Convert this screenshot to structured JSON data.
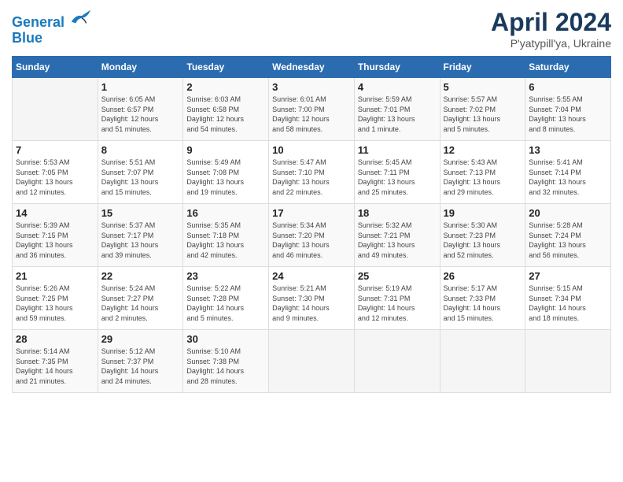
{
  "header": {
    "logo_line1": "General",
    "logo_line2": "Blue",
    "title": "April 2024",
    "subtitle": "P'yatypill'ya, Ukraine"
  },
  "columns": [
    "Sunday",
    "Monday",
    "Tuesday",
    "Wednesday",
    "Thursday",
    "Friday",
    "Saturday"
  ],
  "weeks": [
    [
      {
        "day": "",
        "info": ""
      },
      {
        "day": "1",
        "info": "Sunrise: 6:05 AM\nSunset: 6:57 PM\nDaylight: 12 hours\nand 51 minutes."
      },
      {
        "day": "2",
        "info": "Sunrise: 6:03 AM\nSunset: 6:58 PM\nDaylight: 12 hours\nand 54 minutes."
      },
      {
        "day": "3",
        "info": "Sunrise: 6:01 AM\nSunset: 7:00 PM\nDaylight: 12 hours\nand 58 minutes."
      },
      {
        "day": "4",
        "info": "Sunrise: 5:59 AM\nSunset: 7:01 PM\nDaylight: 13 hours\nand 1 minute."
      },
      {
        "day": "5",
        "info": "Sunrise: 5:57 AM\nSunset: 7:02 PM\nDaylight: 13 hours\nand 5 minutes."
      },
      {
        "day": "6",
        "info": "Sunrise: 5:55 AM\nSunset: 7:04 PM\nDaylight: 13 hours\nand 8 minutes."
      }
    ],
    [
      {
        "day": "7",
        "info": "Sunrise: 5:53 AM\nSunset: 7:05 PM\nDaylight: 13 hours\nand 12 minutes."
      },
      {
        "day": "8",
        "info": "Sunrise: 5:51 AM\nSunset: 7:07 PM\nDaylight: 13 hours\nand 15 minutes."
      },
      {
        "day": "9",
        "info": "Sunrise: 5:49 AM\nSunset: 7:08 PM\nDaylight: 13 hours\nand 19 minutes."
      },
      {
        "day": "10",
        "info": "Sunrise: 5:47 AM\nSunset: 7:10 PM\nDaylight: 13 hours\nand 22 minutes."
      },
      {
        "day": "11",
        "info": "Sunrise: 5:45 AM\nSunset: 7:11 PM\nDaylight: 13 hours\nand 25 minutes."
      },
      {
        "day": "12",
        "info": "Sunrise: 5:43 AM\nSunset: 7:13 PM\nDaylight: 13 hours\nand 29 minutes."
      },
      {
        "day": "13",
        "info": "Sunrise: 5:41 AM\nSunset: 7:14 PM\nDaylight: 13 hours\nand 32 minutes."
      }
    ],
    [
      {
        "day": "14",
        "info": "Sunrise: 5:39 AM\nSunset: 7:15 PM\nDaylight: 13 hours\nand 36 minutes."
      },
      {
        "day": "15",
        "info": "Sunrise: 5:37 AM\nSunset: 7:17 PM\nDaylight: 13 hours\nand 39 minutes."
      },
      {
        "day": "16",
        "info": "Sunrise: 5:35 AM\nSunset: 7:18 PM\nDaylight: 13 hours\nand 42 minutes."
      },
      {
        "day": "17",
        "info": "Sunrise: 5:34 AM\nSunset: 7:20 PM\nDaylight: 13 hours\nand 46 minutes."
      },
      {
        "day": "18",
        "info": "Sunrise: 5:32 AM\nSunset: 7:21 PM\nDaylight: 13 hours\nand 49 minutes."
      },
      {
        "day": "19",
        "info": "Sunrise: 5:30 AM\nSunset: 7:23 PM\nDaylight: 13 hours\nand 52 minutes."
      },
      {
        "day": "20",
        "info": "Sunrise: 5:28 AM\nSunset: 7:24 PM\nDaylight: 13 hours\nand 56 minutes."
      }
    ],
    [
      {
        "day": "21",
        "info": "Sunrise: 5:26 AM\nSunset: 7:25 PM\nDaylight: 13 hours\nand 59 minutes."
      },
      {
        "day": "22",
        "info": "Sunrise: 5:24 AM\nSunset: 7:27 PM\nDaylight: 14 hours\nand 2 minutes."
      },
      {
        "day": "23",
        "info": "Sunrise: 5:22 AM\nSunset: 7:28 PM\nDaylight: 14 hours\nand 5 minutes."
      },
      {
        "day": "24",
        "info": "Sunrise: 5:21 AM\nSunset: 7:30 PM\nDaylight: 14 hours\nand 9 minutes."
      },
      {
        "day": "25",
        "info": "Sunrise: 5:19 AM\nSunset: 7:31 PM\nDaylight: 14 hours\nand 12 minutes."
      },
      {
        "day": "26",
        "info": "Sunrise: 5:17 AM\nSunset: 7:33 PM\nDaylight: 14 hours\nand 15 minutes."
      },
      {
        "day": "27",
        "info": "Sunrise: 5:15 AM\nSunset: 7:34 PM\nDaylight: 14 hours\nand 18 minutes."
      }
    ],
    [
      {
        "day": "28",
        "info": "Sunrise: 5:14 AM\nSunset: 7:35 PM\nDaylight: 14 hours\nand 21 minutes."
      },
      {
        "day": "29",
        "info": "Sunrise: 5:12 AM\nSunset: 7:37 PM\nDaylight: 14 hours\nand 24 minutes."
      },
      {
        "day": "30",
        "info": "Sunrise: 5:10 AM\nSunset: 7:38 PM\nDaylight: 14 hours\nand 28 minutes."
      },
      {
        "day": "",
        "info": ""
      },
      {
        "day": "",
        "info": ""
      },
      {
        "day": "",
        "info": ""
      },
      {
        "day": "",
        "info": ""
      }
    ]
  ]
}
